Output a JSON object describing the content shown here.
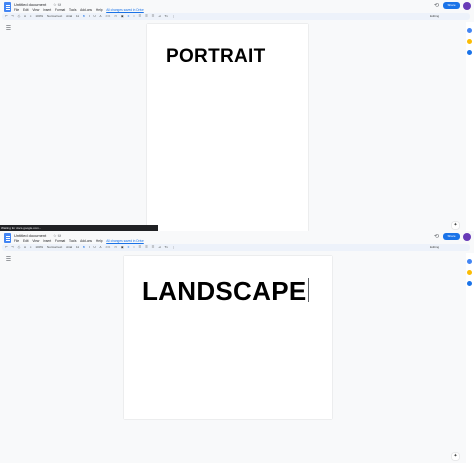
{
  "app": {
    "doc_title": "Untitled document",
    "title_icons": "☆ ⛁",
    "share_label": "Share",
    "editing_label": "Editing",
    "history_icon": "history-icon",
    "menu": [
      "File",
      "Edit",
      "View",
      "Insert",
      "Format",
      "Tools",
      "Add-ons",
      "Help"
    ],
    "last_edit": "All changes saved in Drive",
    "toolbar": {
      "undo": "↶",
      "redo": "↷",
      "print": "⎙",
      "spellcheck": "A",
      "paint_format": "⌖",
      "zoom": "100%",
      "style": "Normal text",
      "font": "Arial",
      "size": "11",
      "bold": "B",
      "italic": "I",
      "underline": "U",
      "text_color": "A",
      "link": "⊂⊃",
      "comment": "▭",
      "image": "▣",
      "align": "≡",
      "line_spacing": "↕",
      "checklist": "☰",
      "bullets": "☰",
      "numbered": "☰",
      "indent": "⇥",
      "clear": "Tx",
      "more": "⋮"
    },
    "colors": {
      "accent": "#1a73e8",
      "avatar": "#673ab7",
      "toolbar_bg": "#edf2fa"
    },
    "side_rail": [
      "calendar-icon",
      "keep-icon",
      "tasks-icon"
    ]
  },
  "top_window": {
    "heading": "PORTRAIT",
    "status_text": "Waiting for docs.google.com..."
  },
  "bottom_window": {
    "heading": "LANDSCAPE"
  },
  "icons": {
    "outline": "☰",
    "explore": "✦"
  }
}
